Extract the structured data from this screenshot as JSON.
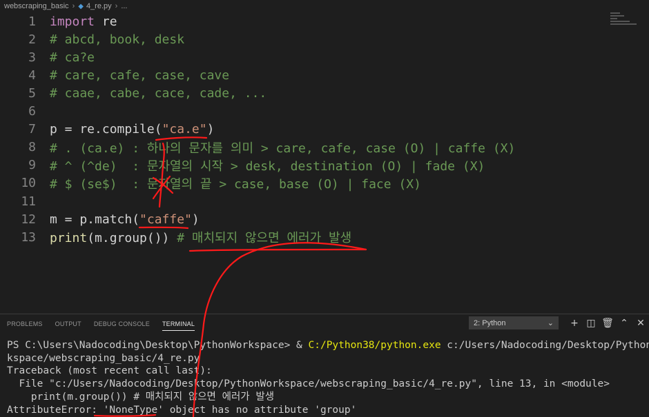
{
  "breadcrumb": {
    "folder": "webscraping_basic",
    "file": "4_re.py",
    "more": "..."
  },
  "editor": {
    "lines": [
      {
        "n": "1",
        "parts": [
          [
            "kw",
            "import"
          ],
          [
            "tx",
            " re"
          ]
        ]
      },
      {
        "n": "2",
        "parts": [
          [
            "cm",
            "# abcd, book, desk"
          ]
        ]
      },
      {
        "n": "3",
        "parts": [
          [
            "cm",
            "# ca?e"
          ]
        ]
      },
      {
        "n": "4",
        "parts": [
          [
            "cm",
            "# care, cafe, case, cave"
          ]
        ]
      },
      {
        "n": "5",
        "parts": [
          [
            "cm",
            "# caae, cabe, cace, cade, ..."
          ]
        ]
      },
      {
        "n": "6",
        "parts": []
      },
      {
        "n": "7",
        "parts": [
          [
            "tx",
            "p = re.compile("
          ],
          [
            "st",
            "\"ca.e\""
          ],
          [
            "tx",
            ")"
          ]
        ]
      },
      {
        "n": "8",
        "parts": [
          [
            "cm",
            "# . (ca.e) : 하나의 문자를 의미 > care, cafe, case (O) | caffe (X)"
          ]
        ]
      },
      {
        "n": "9",
        "parts": [
          [
            "cm",
            "# ^ (^de)  : 문자열의 시작 > desk, destination (O) | fade (X)"
          ]
        ]
      },
      {
        "n": "10",
        "parts": [
          [
            "cm",
            "# $ (se$)  : 문자열의 끝 > case, base (O) | face (X)"
          ]
        ]
      },
      {
        "n": "11",
        "parts": []
      },
      {
        "n": "12",
        "parts": [
          [
            "tx",
            "m = p.match("
          ],
          [
            "st",
            "\"caffe\""
          ],
          [
            "tx",
            ")"
          ]
        ]
      },
      {
        "n": "13",
        "parts": [
          [
            "fn",
            "print"
          ],
          [
            "tx",
            "(m.group()) "
          ],
          [
            "cm",
            "# 매치되지 않으면 에러가 발생"
          ]
        ]
      }
    ]
  },
  "panel": {
    "tabs": [
      "PROBLEMS",
      "OUTPUT",
      "DEBUG CONSOLE",
      "TERMINAL"
    ],
    "active_tab": "TERMINAL",
    "terminal_select": "2: Python",
    "terminal_lines": [
      [
        [
          "n",
          "PS C:\\Users\\Nadocoding\\Desktop\\PythonWorkspace> & "
        ],
        [
          "y",
          "C:/Python38/python.exe"
        ],
        [
          "n",
          " c:/Users/Nadocoding/Desktop/PythonWor"
        ]
      ],
      [
        [
          "n",
          "kspace/webscraping_basic/4_re.py"
        ]
      ],
      [
        [
          "n",
          "Traceback (most recent call last):"
        ]
      ],
      [
        [
          "n",
          "  File \"c:/Users/Nadocoding/Desktop/PythonWorkspace/webscraping_basic/4_re.py\", line 13, in <module>"
        ]
      ],
      [
        [
          "n",
          "    print(m.group()) # 매치되지 않으면 에러가 발생"
        ]
      ],
      [
        [
          "n",
          "AttributeError: 'NoneType' object has no attribute 'group'"
        ]
      ]
    ]
  },
  "colors": {
    "keyword": "#c586c0",
    "comment": "#6a9955",
    "string": "#ce9178",
    "annotation": "#ff1a1a"
  }
}
